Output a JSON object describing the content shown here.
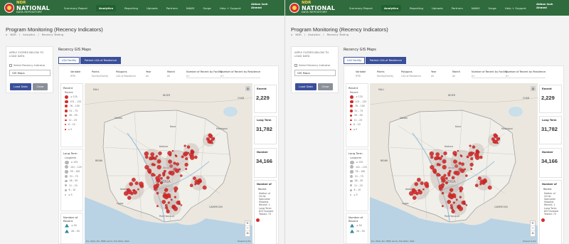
{
  "brand": {
    "ndr": "NDR",
    "name": "NATIONAL",
    "subtitle": "DATA REPOSITORY"
  },
  "nav": {
    "items": [
      "Summary Report",
      "Analytics",
      "Reporting",
      "Uploads",
      "Partners",
      "NAWS",
      "Surge",
      "Help + Support"
    ],
    "active_index": 1,
    "user_first": "Abbas Isah",
    "user_last": "Ahmed"
  },
  "page": {
    "title": "Program Monitoring (Recency Indicators)",
    "breadcrumb": [
      "NDR",
      "Analytics",
      "Recency Testing"
    ]
  },
  "filter": {
    "title": "APPLY FILTERS BELOW TO LOAD DATA",
    "checkbox_label": "Select Recency Indicator",
    "select_value": "GIS Maps",
    "load_label": "Load Data",
    "clear_label": "Clear"
  },
  "content": {
    "section_title": "Recency GIS Maps",
    "tab_lga": "LGA Facility",
    "tab_patient": "Patient LGA of Residence"
  },
  "tableau_filters": [
    {
      "name": "Variable",
      "value": "RTRI"
    },
    {
      "name": "Points",
      "value": "Facility/Facility"
    },
    {
      "name": "Polygons",
      "value": "LGA of Residence"
    },
    {
      "name": "Year",
      "value": "All"
    },
    {
      "name": "Month",
      "value": "All"
    },
    {
      "name": "Number of Recent by Facility",
      "value": "0+"
    },
    {
      "name": "Number of Recent by Residence",
      "value": "0+"
    }
  ],
  "legends": {
    "recent": {
      "title": "Recent",
      "subtitle": "Recent",
      "items": [
        "≥ 125",
        "101 – 125",
        "76 – 100",
        "51 – 75",
        "26 – 50",
        "11 – 25",
        "6 – 10",
        "≤ 5"
      ],
      "color": "#d62a2a"
    },
    "long_term": {
      "title": "Long Term",
      "subtitle": "Longterm",
      "items": [
        "≥ 125",
        "101 – 125",
        "76 – 100",
        "51 – 75",
        "26 – 50",
        "11 – 25",
        "6 – 10",
        "≤ 5"
      ],
      "color": "#b5b5b5"
    },
    "number_of": {
      "title": "Number of Recent",
      "items": [
        "≥ 50",
        "26 – 50"
      ],
      "color": "#2f8a9a"
    }
  },
  "kpis": [
    {
      "label": "Recent",
      "value": "2,229"
    },
    {
      "label": "Long Term",
      "value": "31,782"
    },
    {
      "label": "Number",
      "value": "34,166"
    }
  ],
  "tooltip": {
    "head": "Number of",
    "sub": "Recent",
    "body": "Mother of Christ Specialist Hospital Recent: 1 Long Term: 623 Number Tested: 73"
  },
  "map": {
    "labels": [
      "NIGER",
      "MALI",
      "BENIN",
      "CHAD",
      "Maiduguri",
      "Kano",
      "Sokoto",
      "Kaduna",
      "Abuja",
      "Lagos",
      "Ibadan",
      "NIGERIA",
      "Port Harcourt",
      "CAMEROON"
    ],
    "attribution": "Esri, USGS | Esri, HERE, Garmin, FAO, NOAA, USGS",
    "powered": "Powered by Esri"
  }
}
